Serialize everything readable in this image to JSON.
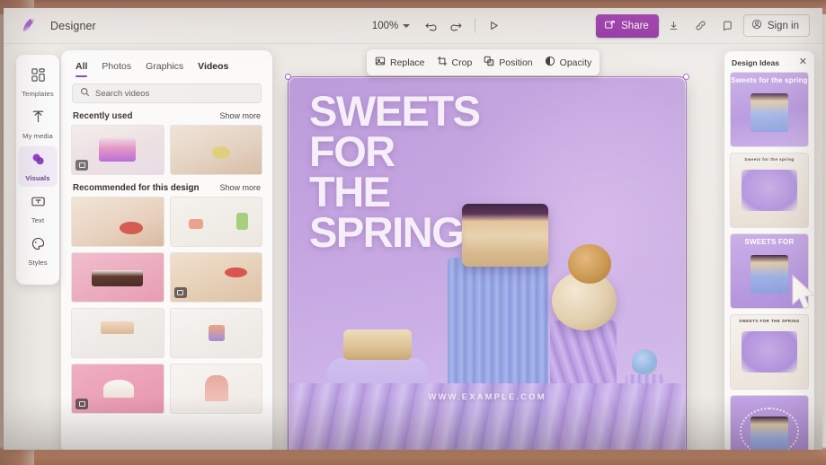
{
  "app": {
    "name": "Designer",
    "logo_icon": "designer-logo-icon"
  },
  "topbar": {
    "zoom_level": "100%",
    "zoom_chevron_icon": "chevron-down-icon",
    "undo_icon": "undo-icon",
    "redo_icon": "redo-icon",
    "play_icon": "play-icon",
    "share_label": "Share",
    "share_icon": "share-icon",
    "share_color": "#9a2fae",
    "download_icon": "download-icon",
    "link_icon": "link-icon",
    "feedback_icon": "feedback-icon",
    "signin_label": "Sign in",
    "signin_icon": "account-icon"
  },
  "sidebar": {
    "items": [
      {
        "label": "Templates",
        "icon": "templates-grid-icon",
        "active": false
      },
      {
        "label": "My media",
        "icon": "upload-arrow-icon",
        "active": false
      },
      {
        "label": "Visuals",
        "icon": "visuals-bubbles-icon",
        "active": true
      },
      {
        "label": "Text",
        "icon": "text-box-icon",
        "active": false
      },
      {
        "label": "Styles",
        "icon": "styles-palette-icon",
        "active": false
      }
    ]
  },
  "panel": {
    "tabs": [
      {
        "label": "All",
        "active": true
      },
      {
        "label": "Photos",
        "active": false
      },
      {
        "label": "Graphics",
        "active": false
      },
      {
        "label": "Videos",
        "active": false,
        "bold": true
      }
    ],
    "search": {
      "placeholder": "Search videos",
      "icon": "search-icon"
    },
    "sections": [
      {
        "title": "Recently used",
        "more_label": "Show more",
        "items": [
          {
            "name": "pink-tiered-cake-thumbnail",
            "video": true
          },
          {
            "name": "lemon-dessert-table-thumbnail",
            "video": false
          }
        ]
      },
      {
        "title": "Recommended for this design",
        "more_label": "Show more",
        "items": [
          {
            "name": "pastry-plate-thumbnail",
            "video": false
          },
          {
            "name": "dessert-trio-thumbnail",
            "video": false
          },
          {
            "name": "chocolate-cherry-cake-thumbnail",
            "video": false
          },
          {
            "name": "cutting-board-dessert-thumbnail",
            "video": true
          },
          {
            "name": "layer-cake-stand-thumbnail",
            "video": false
          },
          {
            "name": "cupcake-thumbnail",
            "video": false
          },
          {
            "name": "white-pudding-thumbnail",
            "video": true
          },
          {
            "name": "macaron-tower-thumbnail",
            "video": false
          }
        ]
      }
    ]
  },
  "context_toolbar": {
    "items": [
      {
        "label": "Replace",
        "icon": "replace-image-icon"
      },
      {
        "label": "Crop",
        "icon": "crop-icon"
      },
      {
        "label": "Position",
        "icon": "position-layers-icon"
      },
      {
        "label": "Opacity",
        "icon": "opacity-circle-icon"
      }
    ]
  },
  "canvas": {
    "headline_lines": [
      "SWEETS",
      "FOR",
      "THE",
      "SPRING"
    ],
    "headline_text": "SWEETS FOR THE SPRING",
    "site_url": "WWW.EXAMPLE.COM",
    "background_color": "#c4a4e0",
    "headline_color": "#f6eef8",
    "selected": true
  },
  "design_ideas": {
    "title": "Design Ideas",
    "close_icon": "close-icon",
    "items": [
      {
        "name": "idea-purple-centered",
        "caption": "Sweets for\nthe spring"
      },
      {
        "name": "idea-cream-repeat-text",
        "caption": "Sweets for the spring"
      },
      {
        "name": "idea-purple-uppercase",
        "caption": "SWEETS FOR"
      },
      {
        "name": "idea-cream-framed",
        "caption": "SWEETS FOR THE SPRING"
      },
      {
        "name": "idea-purple-circular-text",
        "caption": "SWEETS FOR THE SPRING"
      }
    ]
  },
  "cursor": {
    "icon": "pointer-cursor-icon"
  }
}
